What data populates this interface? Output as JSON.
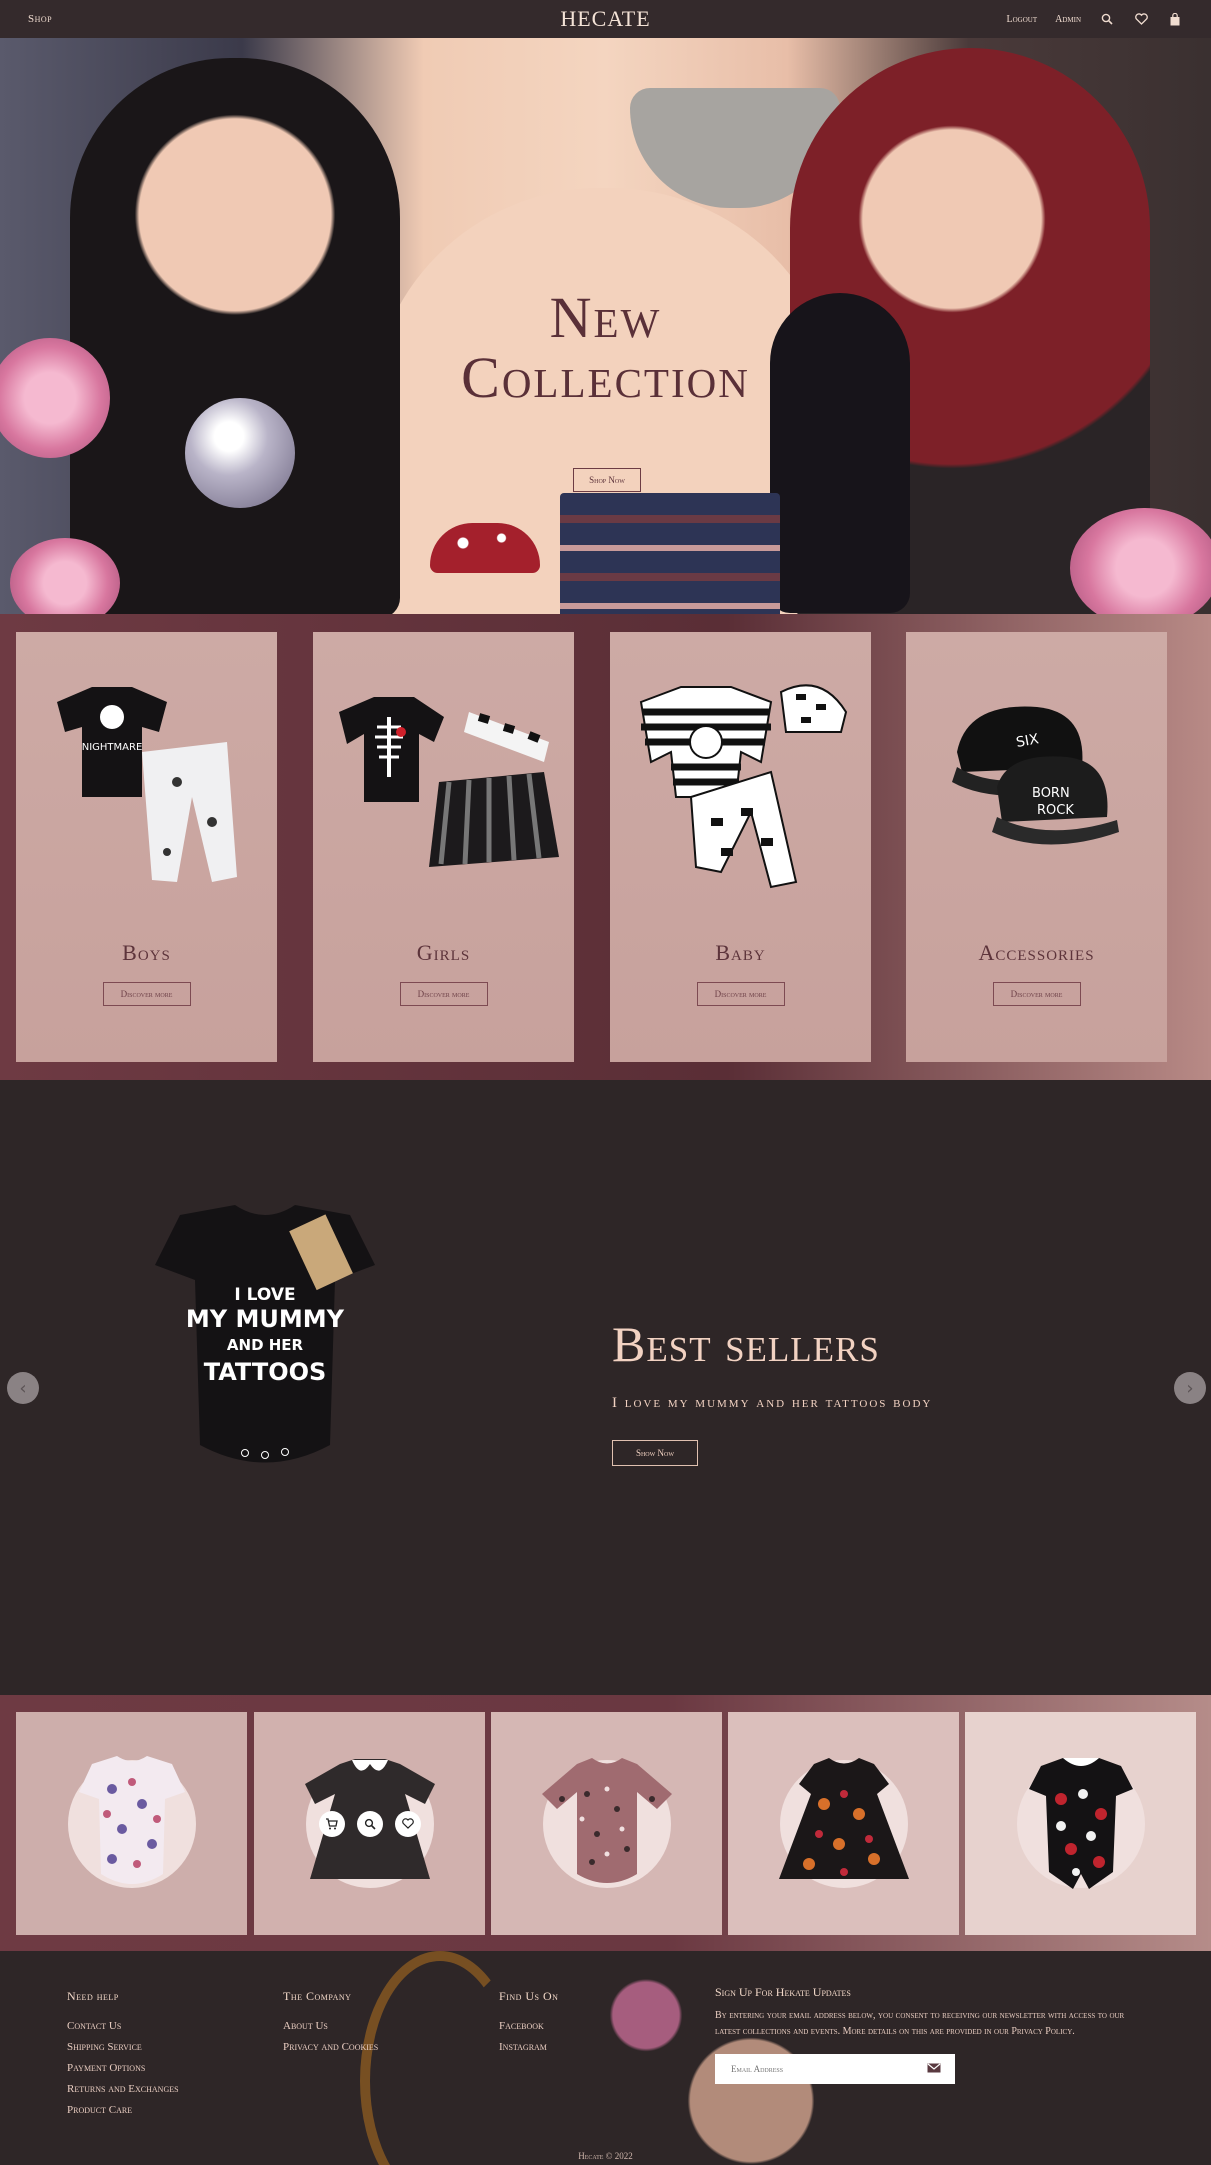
{
  "nav": {
    "shop": "Shop",
    "brand": "HECATE",
    "logout": "Logout",
    "admin": "Admin",
    "icons": [
      "search-icon",
      "heart-icon",
      "bag-icon"
    ]
  },
  "hero": {
    "title_line1": "New",
    "title_line2": "Collection",
    "button": "Shop Now"
  },
  "categories": [
    {
      "name": "Boys",
      "button": "Discover more"
    },
    {
      "name": "Girls",
      "button": "Discover more"
    },
    {
      "name": "Baby",
      "button": "Discover more"
    },
    {
      "name": "Accessories",
      "button": "Discover more"
    }
  ],
  "best": {
    "heading": "Best sellers",
    "product": "I love my mummy and her tattoos body",
    "button": "Show Now",
    "shirt_text": [
      "I LOVE",
      "MY MUMMY",
      "AND HER",
      "TATTOOS"
    ]
  },
  "footer": {
    "help": {
      "title": "Need help",
      "links": [
        "Contact Us",
        "Shipping Service",
        "Payment Options",
        "Returns and Exchanges",
        "Product Care"
      ]
    },
    "company": {
      "title": "The Company",
      "links": [
        "About Us",
        "Privacy and Cookies"
      ]
    },
    "find": {
      "title": "Find Us On",
      "links": [
        "Facebook",
        "Instagram"
      ]
    },
    "news": {
      "title": "Sign Up For Hekate Updates",
      "text": "By entering your email address below, you consent to receiving our newsletter with access to our latest collections and events. More details on this are provided in our Privacy Policy.",
      "placeholder": "Email Address"
    },
    "copyright": "Hecate © 2022"
  },
  "colors": {
    "accent": "#6e3a43",
    "dark": "#2e2627",
    "card": "#cdaaa5",
    "text_light": "#f2d2c2"
  }
}
